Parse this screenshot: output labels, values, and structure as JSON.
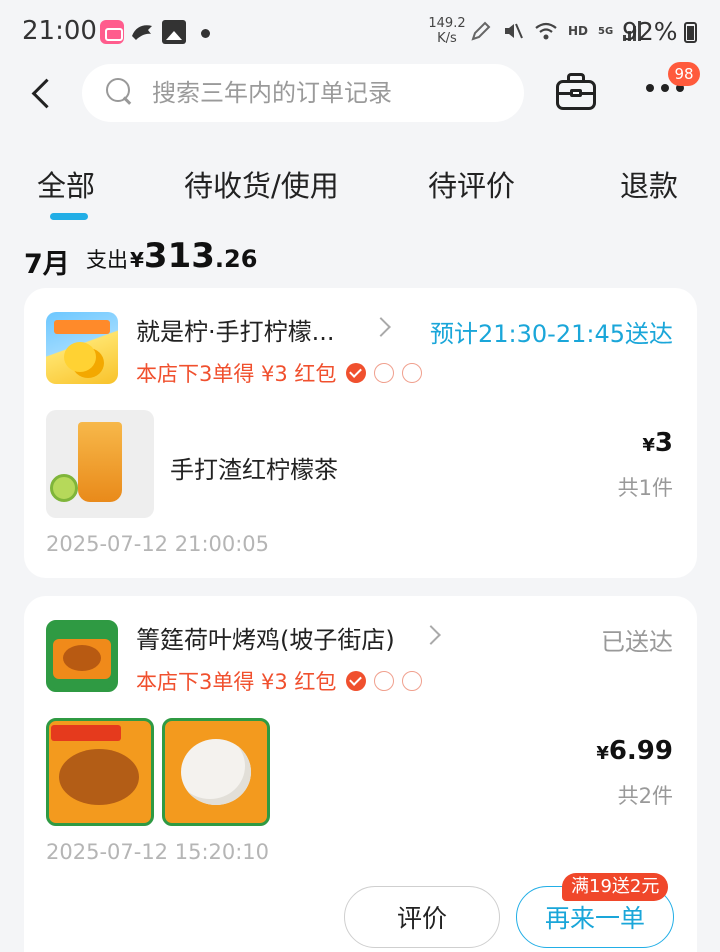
{
  "status_bar": {
    "time": "21:00",
    "net_speed_value": "149.2",
    "net_speed_unit": "K/s",
    "hd": "HD",
    "network": "5G",
    "battery": "92%"
  },
  "header": {
    "search_placeholder": "搜索三年内的订单记录",
    "message_badge": "98"
  },
  "tabs": [
    {
      "label": "全部",
      "active": true
    },
    {
      "label": "待收货/使用"
    },
    {
      "label": "待评价"
    },
    {
      "label": "退款"
    }
  ],
  "summary": {
    "month": "7月",
    "spend_label": "支出",
    "currency": "¥",
    "amount_int": "313",
    "amount_dec": ".26"
  },
  "orders": [
    {
      "store_name": "就是柠·手打柠檬...",
      "status": "预计21:30-21:45送达",
      "promo": "本店下3单得 ¥3 红包",
      "item_name": "手打渣红柠檬茶",
      "currency": "¥",
      "price": "3",
      "count": "共1件",
      "time": "2025-07-12 21:00:05"
    },
    {
      "store_name": "箐筳荷叶烤鸡(坡子街店)",
      "status": "已送达",
      "promo": "本店下3单得 ¥3 红包",
      "currency": "¥",
      "price": "6.99",
      "count": "共2件",
      "time": "2025-07-12 15:20:10",
      "review_button": "评价",
      "reorder_button": "再来一单",
      "reorder_tag": "满19送2元"
    }
  ],
  "colors": {
    "accent": "#22aee6",
    "promo": "#f0502e",
    "background": "#f4f5f7"
  }
}
